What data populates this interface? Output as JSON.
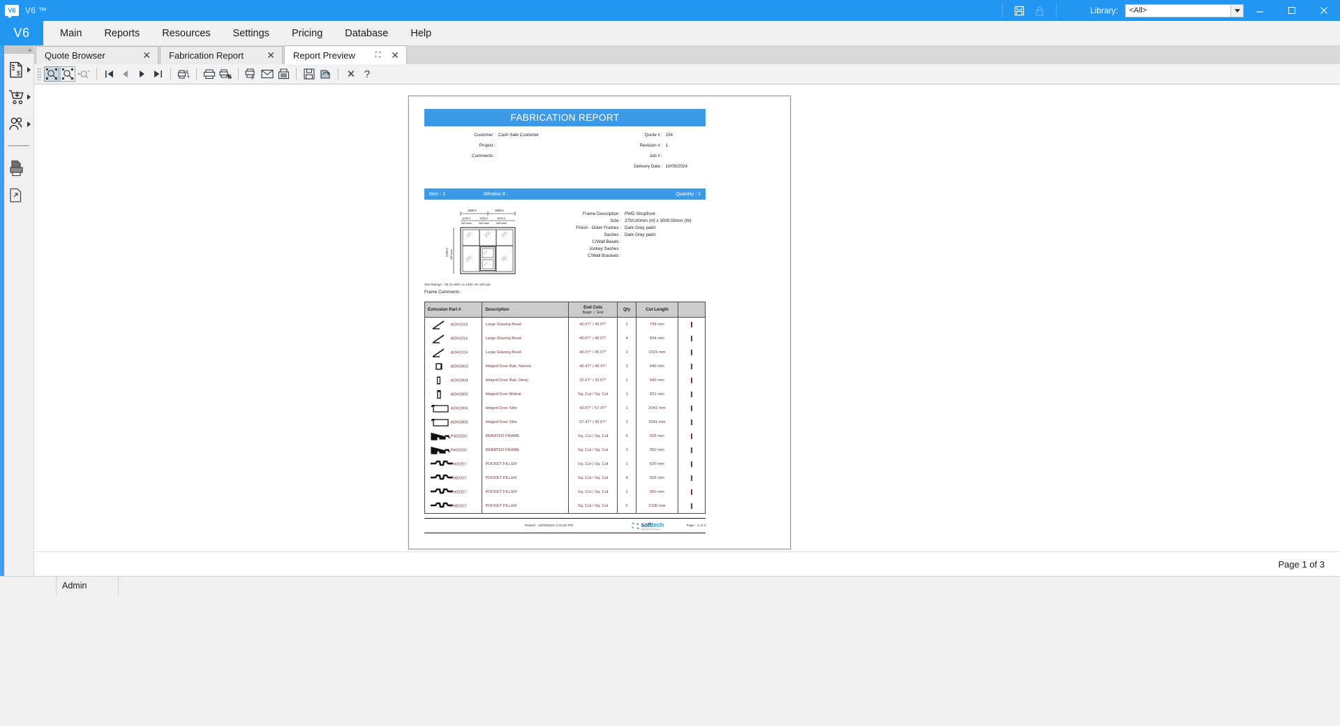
{
  "titlebar": {
    "app_title": "V6 ™",
    "logo_text": "V6",
    "library_label": "Library:",
    "library_value": "<All>",
    "save_icon": "save-icon",
    "lock_icon": "lock-icon"
  },
  "menubar": {
    "brand": "V6",
    "items": [
      {
        "label": "Main"
      },
      {
        "label": "Reports"
      },
      {
        "label": "Resources"
      },
      {
        "label": "Settings"
      },
      {
        "label": "Pricing"
      },
      {
        "label": "Database"
      },
      {
        "label": "Help"
      }
    ]
  },
  "sidebar": {
    "items": [
      {
        "name": "quotes-icon",
        "caret": true
      },
      {
        "name": "orders-cart-icon",
        "caret": true
      },
      {
        "name": "customers-icon",
        "caret": true
      },
      {
        "name": "print-reports-icon",
        "caret": false
      },
      {
        "name": "export-icon",
        "caret": false
      }
    ]
  },
  "tabs": [
    {
      "label": "Quote Browser",
      "active": false,
      "closable": true
    },
    {
      "label": "Fabrication Report",
      "active": false,
      "closable": true
    },
    {
      "label": "Report Preview",
      "active": true,
      "closable": true,
      "expandable": true
    }
  ],
  "preview_toolbar": {
    "buttons": [
      {
        "name": "zoom-fit-page-button",
        "state": "pressed"
      },
      {
        "name": "zoom-fit-width-button",
        "state": "framed"
      },
      {
        "name": "zoom-custom-button",
        "state": "normal"
      },
      {
        "name": "first-page-button",
        "state": "normal"
      },
      {
        "name": "previous-page-button",
        "state": "normal"
      },
      {
        "name": "next-page-button",
        "state": "normal"
      },
      {
        "name": "last-page-button",
        "state": "normal"
      },
      {
        "name": "page-setup-button",
        "state": "normal"
      },
      {
        "name": "print-button",
        "state": "normal"
      },
      {
        "name": "print-options-button",
        "state": "normal"
      },
      {
        "name": "export-pdf-button",
        "state": "normal"
      },
      {
        "name": "email-button",
        "state": "normal"
      },
      {
        "name": "fax-button",
        "state": "normal"
      },
      {
        "name": "save-button",
        "state": "normal"
      },
      {
        "name": "refresh-button",
        "state": "normal"
      },
      {
        "name": "close-button",
        "state": "normal"
      },
      {
        "name": "help-button",
        "state": "normal"
      }
    ],
    "help_glyph": "?",
    "close_glyph": "✕"
  },
  "report": {
    "title": "FABRICATION REPORT",
    "meta_left": [
      {
        "label": "Customer :",
        "value": "Cash Sale Customer"
      },
      {
        "label": "Project :",
        "value": ""
      },
      {
        "label": "Comments :",
        "value": ""
      }
    ],
    "meta_right": [
      {
        "label": "Quote # :",
        "value": "154"
      },
      {
        "label": "Revision # :",
        "value": "1"
      },
      {
        "label": "Job # :",
        "value": ""
      },
      {
        "label": "Delivery Date :",
        "value": "10/09/2024"
      }
    ],
    "item_bar": {
      "item": "Item :  1",
      "window": "Window # :",
      "quantity": "Quantity :  1"
    },
    "drawing": {
      "top_dims": [
        "1500.0",
        "1500.0"
      ],
      "inner_dims": [
        "1000.0",
        "1000.0",
        "1000.0"
      ],
      "inner_labels": [
        "W/Frame",
        "W/Frame",
        "W/Frame"
      ],
      "side_dim": "2750.0",
      "side_label": "W/Frame"
    },
    "frame_details": [
      {
        "label": "Frame Description :",
        "value": "PWD Shopfront"
      },
      {
        "label": "Size :",
        "value": "2750.00mm (H) x 3000.00mm (W)"
      },
      {
        "label": "Finish -   Outer Frames :",
        "value": "Dark Grey paint"
      },
      {
        "label": "Sashes :",
        "value": "Dark Grey paint"
      },
      {
        "label": "C/Wall Beads :",
        "value": ""
      },
      {
        "label": "Jockey Sashes :",
        "value": ""
      },
      {
        "label": "C/Wall Brackets :",
        "value": ""
      }
    ],
    "site_ratings": "Site Ratings :  N3  (S=800, U=1400, W=150 pa)",
    "frame_comments": "Frame Comments :",
    "table": {
      "headers": {
        "part": "Extrusion Part #",
        "description": "Description",
        "endcuts": "End Cuts",
        "endcuts_sub_begin": "Begin",
        "endcuts_sub_sep": "/",
        "endcuts_sub_end": "End",
        "qty": "Qty",
        "cut_length": "Cut Length",
        "check": ""
      },
      "rows": [
        {
          "profile": "angle",
          "part": "ADH1016",
          "description": "Large Glazing Bead",
          "begin": "45.0T°",
          "end": "45.0T°",
          "qty": "2",
          "cut_length": "799 mm"
        },
        {
          "profile": "angle",
          "part": "ADH1016",
          "description": "Large Glazing Bead",
          "begin": "45.0T°",
          "end": "45.0T°",
          "qty": "4",
          "cut_length": "834 mm"
        },
        {
          "profile": "angle",
          "part": "ADH1016",
          "description": "Large Glazing Bead",
          "begin": "45.0T°",
          "end": "45.0T°",
          "qty": "2",
          "cut_length": "1019 mm"
        },
        {
          "profile": "box-small",
          "part": "ADH2003",
          "description": "Hinged Door Rail, Narrow",
          "begin": "46.4T°",
          "end": "46.4T°",
          "qty": "1",
          "cut_length": "940 mm"
        },
        {
          "profile": "box-tall",
          "part": "ADH2004",
          "description": "Hinged Door Rail, Deep",
          "begin": "32.6T°",
          "end": "32.6T°",
          "qty": "1",
          "cut_length": "940 mm"
        },
        {
          "profile": "box-thin",
          "part": "ADH2005",
          "description": "Hinged Door Midrail",
          "begin": "Sq. Cut",
          "end": "Sq. Cut",
          "qty": "1",
          "cut_length": "831 mm"
        },
        {
          "profile": "stile",
          "part": "ADH2006",
          "description": "Hinged Door Stile",
          "begin": "43.6T°",
          "end": "57.4T°",
          "qty": "1",
          "cut_length": "2041 mm"
        },
        {
          "profile": "stile",
          "part": "ADH2006",
          "description": "Hinged Door Stile",
          "begin": "57.4T°",
          "end": "43.6T°",
          "qty": "1",
          "cut_length": "2041 mm"
        },
        {
          "profile": "rebate",
          "part": "PWD200",
          "description": "REBATED FRAME",
          "begin": "Sq. Cut",
          "end": "Sq. Cut",
          "qty": "6",
          "cut_length": "925 mm"
        },
        {
          "profile": "rebate",
          "part": "PWD200",
          "description": "REBATED FRAME",
          "begin": "Sq. Cut",
          "end": "Sq. Cut",
          "qty": "1",
          "cut_length": "950 mm"
        },
        {
          "profile": "filler",
          "part": "PWD207",
          "description": "POCKET FILLER",
          "begin": "Sq. Cut",
          "end": "Sq. Cut",
          "qty": "1",
          "cut_length": "620 mm"
        },
        {
          "profile": "filler",
          "part": "PWD207",
          "description": "POCKET FILLER",
          "begin": "Sq. Cut",
          "end": "Sq. Cut",
          "qty": "4",
          "cut_length": "925 mm"
        },
        {
          "profile": "filler",
          "part": "PWD207",
          "description": "POCKET FILLER",
          "begin": "Sq. Cut",
          "end": "Sq. Cut",
          "qty": "1",
          "cut_length": "950 mm"
        },
        {
          "profile": "filler",
          "part": "PWD207",
          "description": "POCKET FILLER",
          "begin": "Sq. Cut",
          "end": "Sq. Cut",
          "qty": "2",
          "cut_length": "2100 mm"
        }
      ]
    },
    "footer": {
      "printed": "Printed : 10/09/2024 2:32:28 PM",
      "logo_soft": "soft",
      "logo_tech": "tech",
      "logo_tagline": "Advanced Company",
      "page": "Page : 1 of 3"
    }
  },
  "page_status": {
    "text": "Page 1 of 3"
  },
  "statusbar": {
    "user": "Admin"
  }
}
